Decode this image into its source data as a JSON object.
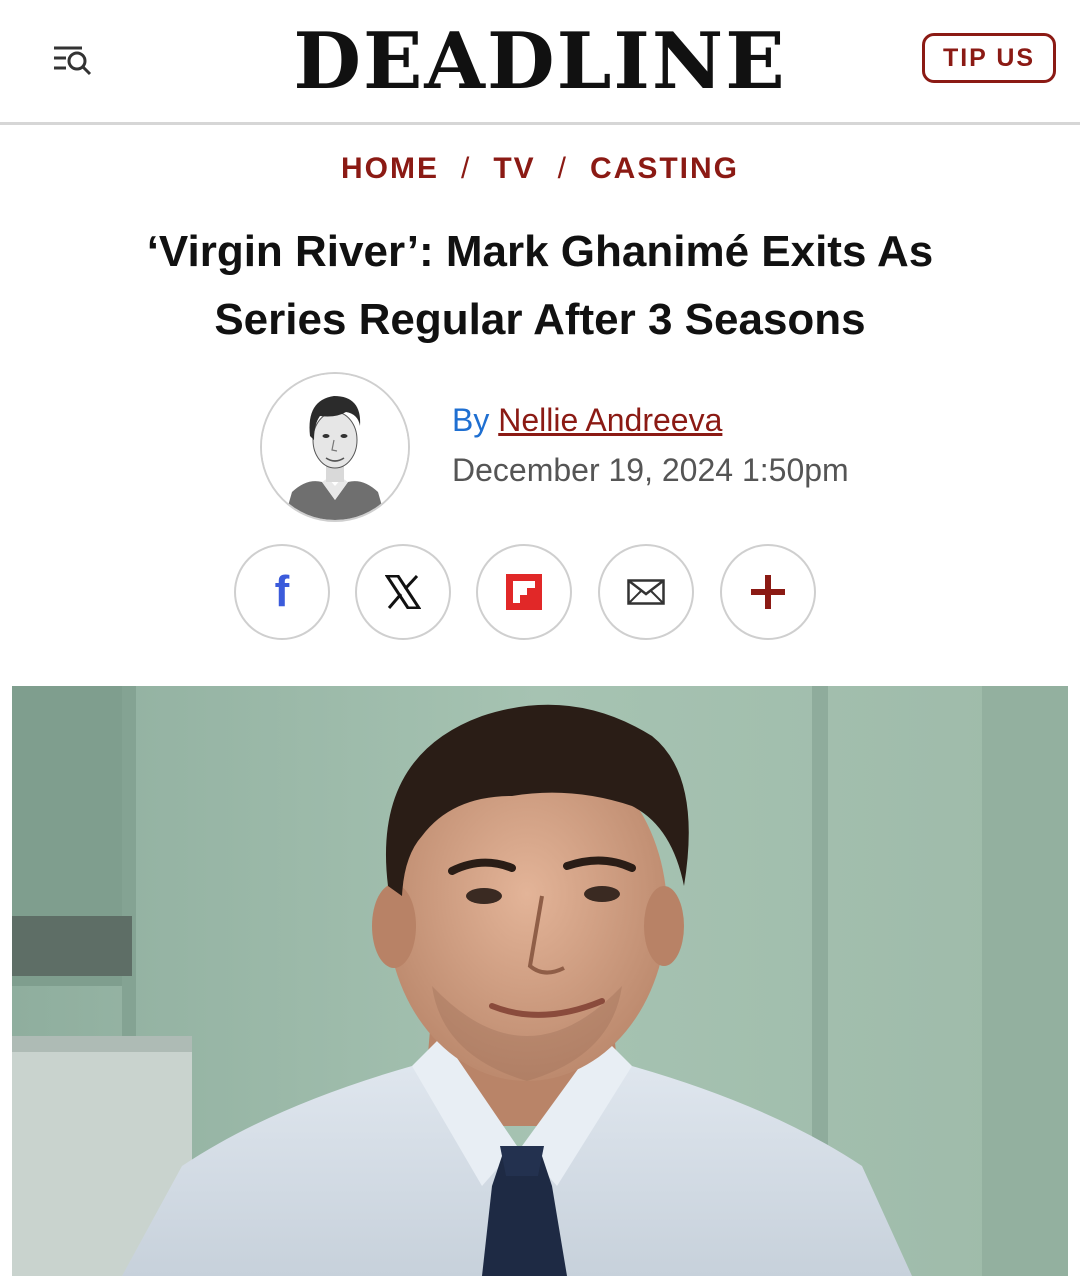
{
  "header": {
    "logo": "DEADLINE",
    "menu_icon": "menu-search-icon",
    "tip_label": "TIP US"
  },
  "breadcrumb": {
    "items": [
      "HOME",
      "TV",
      "CASTING"
    ],
    "separator": "/"
  },
  "article": {
    "title_line1": "‘Virgin River’: Mark Ghanimé Exits As",
    "title_line2": "Series Regular After 3 Seasons",
    "by_prefix": "By",
    "author": "Nellie Andreeva",
    "date": "December 19, 2024 1:50pm"
  },
  "share": {
    "buttons": [
      {
        "icon": "facebook-icon",
        "glyph": "f",
        "color": "#3b5bdb"
      },
      {
        "icon": "x-icon",
        "glyph": "𝕏",
        "color": "#111111"
      },
      {
        "icon": "flipboard-icon",
        "glyph": "",
        "color": "#e12828"
      },
      {
        "icon": "email-icon",
        "glyph": "",
        "color": "#333333"
      },
      {
        "icon": "plus-icon",
        "glyph": "+",
        "color": "#8b1a14"
      }
    ]
  },
  "colors": {
    "accent": "#8b1a14",
    "link_blue": "#1f6fd1"
  }
}
